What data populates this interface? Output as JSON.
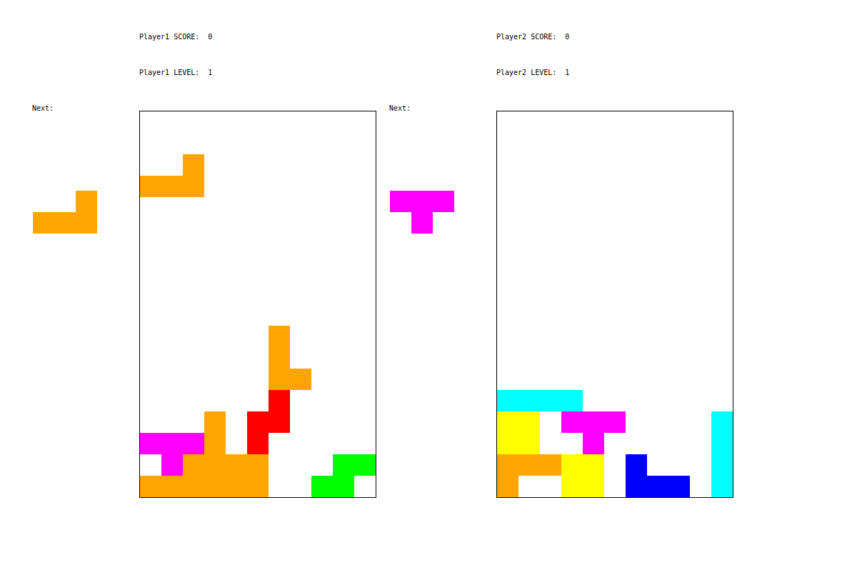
{
  "players": [
    {
      "score_label": "Player1 SCORE:",
      "score": "0",
      "level_label": "Player1 LEVEL:",
      "level": "1",
      "next_label": "Next:",
      "next_piece": {
        "color": "#ffa500",
        "cells": [
          [
            0,
            2
          ],
          [
            1,
            0
          ],
          [
            1,
            1
          ],
          [
            1,
            2
          ]
        ]
      },
      "board": {
        "columns": 11,
        "rows": 18,
        "blocks": [
          {
            "row": 2,
            "col": 2,
            "color": "#ffa500"
          },
          {
            "row": 3,
            "col": 0,
            "color": "#ffa500"
          },
          {
            "row": 3,
            "col": 1,
            "color": "#ffa500"
          },
          {
            "row": 3,
            "col": 2,
            "color": "#ffa500"
          },
          {
            "row": 10,
            "col": 6,
            "color": "#ffa500"
          },
          {
            "row": 11,
            "col": 6,
            "color": "#ffa500"
          },
          {
            "row": 12,
            "col": 6,
            "color": "#ffa500"
          },
          {
            "row": 12,
            "col": 7,
            "color": "#ffa500"
          },
          {
            "row": 13,
            "col": 6,
            "color": "#ff0000"
          },
          {
            "row": 14,
            "col": 6,
            "color": "#ff0000"
          },
          {
            "row": 14,
            "col": 5,
            "color": "#ff0000"
          },
          {
            "row": 15,
            "col": 5,
            "color": "#ff0000"
          },
          {
            "row": 14,
            "col": 3,
            "color": "#ffa500"
          },
          {
            "row": 15,
            "col": 3,
            "color": "#ffa500"
          },
          {
            "row": 16,
            "col": 2,
            "color": "#ffa500"
          },
          {
            "row": 16,
            "col": 3,
            "color": "#ffa500"
          },
          {
            "row": 16,
            "col": 4,
            "color": "#ffa500"
          },
          {
            "row": 16,
            "col": 5,
            "color": "#ffa500"
          },
          {
            "row": 17,
            "col": 0,
            "color": "#ffa500"
          },
          {
            "row": 17,
            "col": 1,
            "color": "#ffa500"
          },
          {
            "row": 17,
            "col": 2,
            "color": "#ffa500"
          },
          {
            "row": 17,
            "col": 3,
            "color": "#ffa500"
          },
          {
            "row": 17,
            "col": 4,
            "color": "#ffa500"
          },
          {
            "row": 17,
            "col": 5,
            "color": "#ffa500"
          },
          {
            "row": 15,
            "col": 0,
            "color": "#ff00ff"
          },
          {
            "row": 15,
            "col": 1,
            "color": "#ff00ff"
          },
          {
            "row": 15,
            "col": 2,
            "color": "#ff00ff"
          },
          {
            "row": 16,
            "col": 1,
            "color": "#ff00ff"
          },
          {
            "row": 16,
            "col": 9,
            "color": "#00ff00"
          },
          {
            "row": 16,
            "col": 10,
            "color": "#00ff00"
          },
          {
            "row": 17,
            "col": 8,
            "color": "#00ff00"
          },
          {
            "row": 17,
            "col": 9,
            "color": "#00ff00"
          }
        ]
      }
    },
    {
      "score_label": "Player2 SCORE:",
      "score": "0",
      "level_label": "Player2 LEVEL:",
      "level": "1",
      "next_label": "Next:",
      "next_piece": {
        "color": "#ff00ff",
        "cells": [
          [
            0,
            0
          ],
          [
            0,
            1
          ],
          [
            0,
            2
          ],
          [
            1,
            1
          ]
        ]
      },
      "board": {
        "columns": 11,
        "rows": 18,
        "blocks": [
          {
            "row": 13,
            "col": 0,
            "color": "#00ffff"
          },
          {
            "row": 13,
            "col": 1,
            "color": "#00ffff"
          },
          {
            "row": 13,
            "col": 2,
            "color": "#00ffff"
          },
          {
            "row": 13,
            "col": 3,
            "color": "#00ffff"
          },
          {
            "row": 14,
            "col": 0,
            "color": "#ffff00"
          },
          {
            "row": 14,
            "col": 1,
            "color": "#ffff00"
          },
          {
            "row": 15,
            "col": 0,
            "color": "#ffff00"
          },
          {
            "row": 15,
            "col": 1,
            "color": "#ffff00"
          },
          {
            "row": 14,
            "col": 3,
            "color": "#ff00ff"
          },
          {
            "row": 14,
            "col": 4,
            "color": "#ff00ff"
          },
          {
            "row": 14,
            "col": 5,
            "color": "#ff00ff"
          },
          {
            "row": 15,
            "col": 4,
            "color": "#ff00ff"
          },
          {
            "row": 16,
            "col": 0,
            "color": "#ffa500"
          },
          {
            "row": 16,
            "col": 1,
            "color": "#ffa500"
          },
          {
            "row": 16,
            "col": 2,
            "color": "#ffa500"
          },
          {
            "row": 17,
            "col": 0,
            "color": "#ffa500"
          },
          {
            "row": 16,
            "col": 3,
            "color": "#ffff00"
          },
          {
            "row": 16,
            "col": 4,
            "color": "#ffff00"
          },
          {
            "row": 17,
            "col": 3,
            "color": "#ffff00"
          },
          {
            "row": 17,
            "col": 4,
            "color": "#ffff00"
          },
          {
            "row": 16,
            "col": 6,
            "color": "#0000ff"
          },
          {
            "row": 17,
            "col": 6,
            "color": "#0000ff"
          },
          {
            "row": 17,
            "col": 7,
            "color": "#0000ff"
          },
          {
            "row": 17,
            "col": 8,
            "color": "#0000ff"
          },
          {
            "row": 14,
            "col": 10,
            "color": "#00ffff"
          },
          {
            "row": 15,
            "col": 10,
            "color": "#00ffff"
          },
          {
            "row": 16,
            "col": 10,
            "color": "#00ffff"
          },
          {
            "row": 17,
            "col": 10,
            "color": "#00ffff"
          }
        ]
      }
    }
  ]
}
